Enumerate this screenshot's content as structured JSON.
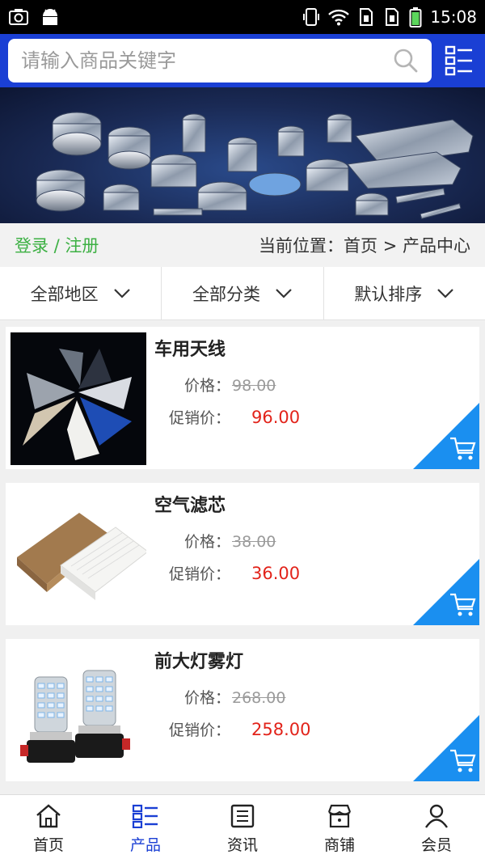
{
  "status_bar": {
    "time": "15:08"
  },
  "search": {
    "placeholder": "请输入商品关键字"
  },
  "breadcrumb": {
    "login": "登录 / 注册",
    "location": "当前位置：首页 > 产品中心"
  },
  "filters": [
    {
      "label": "全部地区"
    },
    {
      "label": "全部分类"
    },
    {
      "label": "默认排序"
    }
  ],
  "price_labels": {
    "price": "价格：",
    "sale": "促销价："
  },
  "products": [
    {
      "name": "车用天线",
      "price": "98.00",
      "sale_price": "96.00"
    },
    {
      "name": "空气滤芯",
      "price": "38.00",
      "sale_price": "36.00"
    },
    {
      "name": "前大灯雾灯",
      "price": "268.00",
      "sale_price": "258.00"
    }
  ],
  "bottom_nav": [
    {
      "label": "首页",
      "icon": "home-icon"
    },
    {
      "label": "产品",
      "icon": "grid-list-icon",
      "active": true
    },
    {
      "label": "资讯",
      "icon": "news-icon"
    },
    {
      "label": "商铺",
      "icon": "store-icon"
    },
    {
      "label": "会员",
      "icon": "user-icon"
    }
  ],
  "colors": {
    "header": "#1a3fd4",
    "accent_green": "#3cb043",
    "sale_red": "#e2231a",
    "cart_blue": "#1a8ff0"
  }
}
